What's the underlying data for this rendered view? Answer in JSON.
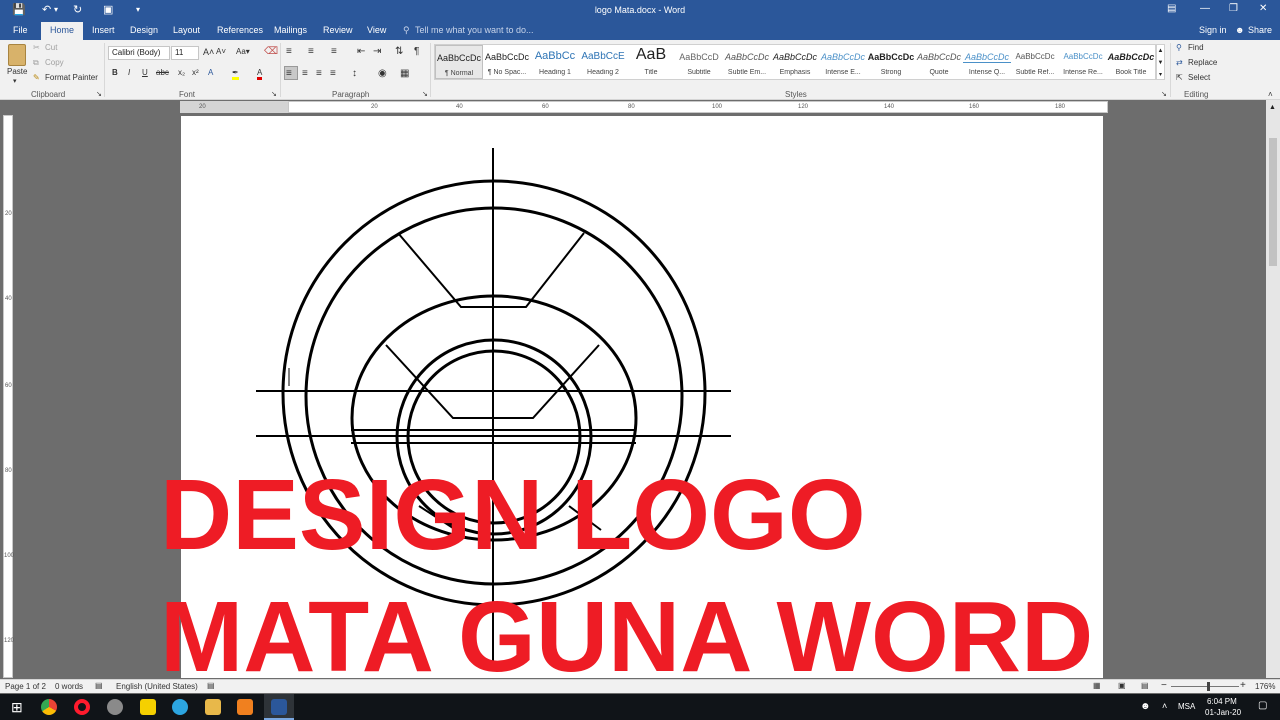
{
  "window": {
    "title": "logo Mata.docx - Word",
    "sign_in": "Sign in",
    "share": "Share"
  },
  "qat": {
    "save_icon": "save-icon",
    "undo_icon": "undo-icon",
    "redo_icon": "redo-icon"
  },
  "tabs": [
    "File",
    "Home",
    "Insert",
    "Design",
    "Layout",
    "References",
    "Mailings",
    "Review",
    "View"
  ],
  "tell_me": "Tell me what you want to do...",
  "clipboard": {
    "paste": "Paste",
    "cut": "Cut",
    "copy": "Copy",
    "format_painter": "Format Painter",
    "label": "Clipboard"
  },
  "font": {
    "family": "Calibri (Body)",
    "size": "11",
    "label": "Font"
  },
  "paragraph": {
    "label": "Paragraph"
  },
  "styles": {
    "label": "Styles",
    "items": [
      {
        "preview": "AaBbCcDc",
        "name": "¶ Normal"
      },
      {
        "preview": "AaBbCcDc",
        "name": "¶ No Spac..."
      },
      {
        "preview": "AaBbCc",
        "name": "Heading 1"
      },
      {
        "preview": "AaBbCcE",
        "name": "Heading 2"
      },
      {
        "preview": "AaB",
        "name": "Title"
      },
      {
        "preview": "AaBbCcD",
        "name": "Subtitle"
      },
      {
        "preview": "AaBbCcDc",
        "name": "Subtle Em..."
      },
      {
        "preview": "AaBbCcDc",
        "name": "Emphasis"
      },
      {
        "preview": "AaBbCcDc",
        "name": "Intense E..."
      },
      {
        "preview": "AaBbCcDc",
        "name": "Strong"
      },
      {
        "preview": "AaBbCcDc",
        "name": "Quote"
      },
      {
        "preview": "AaBbCcDc",
        "name": "Intense Q..."
      },
      {
        "preview": "AaBbCcDc",
        "name": "Subtle Ref..."
      },
      {
        "preview": "AaBbCcDc",
        "name": "Intense Re..."
      },
      {
        "preview": "AaBbCcDc",
        "name": "Book Title"
      }
    ]
  },
  "editing": {
    "find": "Find",
    "replace": "Replace",
    "select": "Select",
    "label": "Editing"
  },
  "ruler": {
    "h_ticks": [
      "20",
      "20",
      "40",
      "60",
      "80",
      "100",
      "120",
      "140",
      "160",
      "180"
    ],
    "v_ticks": [
      "20",
      "40",
      "60",
      "80",
      "100",
      "120"
    ]
  },
  "overlay": {
    "line1": "DESIGN LOGO",
    "line2": "MATA GUNA WORD",
    "color": "#ee1c25"
  },
  "status": {
    "page": "Page 1 of 2",
    "words": "0 words",
    "language": "English (United States)",
    "zoom": "176%"
  },
  "taskbar": {
    "lang": "MSA",
    "time": "6:04 PM",
    "date": "01-Jan-20"
  }
}
